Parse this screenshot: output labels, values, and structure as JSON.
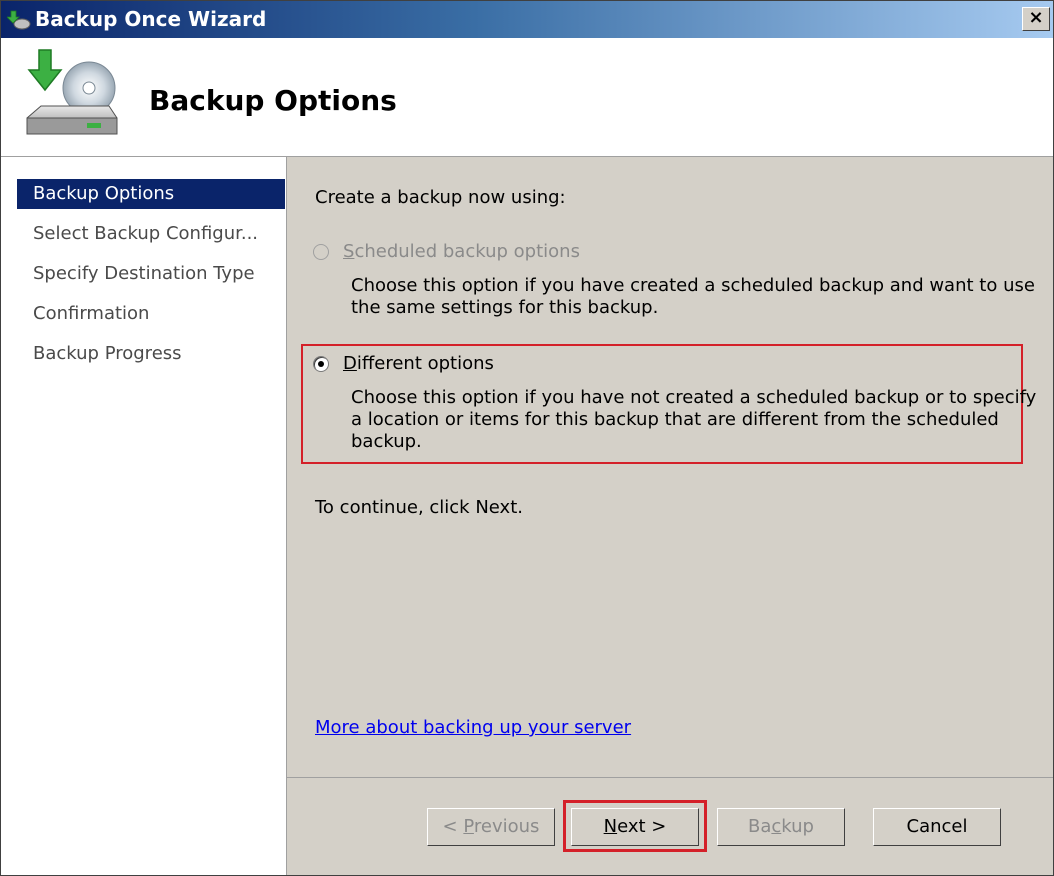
{
  "window": {
    "title": "Backup Once Wizard",
    "close_label": "×"
  },
  "header": {
    "title": "Backup Options"
  },
  "nav": {
    "items": [
      {
        "label": "Backup Options",
        "active": true
      },
      {
        "label": "Select Backup Configur..."
      },
      {
        "label": "Specify Destination Type"
      },
      {
        "label": "Confirmation"
      },
      {
        "label": "Backup Progress"
      }
    ]
  },
  "content": {
    "prompt": "Create a backup now using:",
    "option1": {
      "label_first": "S",
      "label_rest": "cheduled backup options",
      "description": "Choose this option if you have created a scheduled backup and want to use the same settings for this backup.",
      "selected": false,
      "enabled": false
    },
    "option2": {
      "label_first": "D",
      "label_rest": "ifferent options",
      "description": "Choose this option if you have not created a scheduled backup or to specify a location or items for this backup that are different from the scheduled backup.",
      "selected": true,
      "enabled": true
    },
    "continue_text": "To continue, click Next.",
    "more_link": "More about backing up your server"
  },
  "buttons": {
    "previous": {
      "pre": "< ",
      "accel": "P",
      "post": "revious",
      "enabled": false
    },
    "next": {
      "accel": "N",
      "post": "ext >",
      "enabled": true
    },
    "backup": {
      "pre": "Ba",
      "accel": "c",
      "post": "kup",
      "enabled": false
    },
    "cancel": {
      "label": "Cancel",
      "enabled": true
    }
  },
  "colors": {
    "highlight": "#d42029",
    "selection": "#0a246a",
    "link": "#0000ee"
  }
}
